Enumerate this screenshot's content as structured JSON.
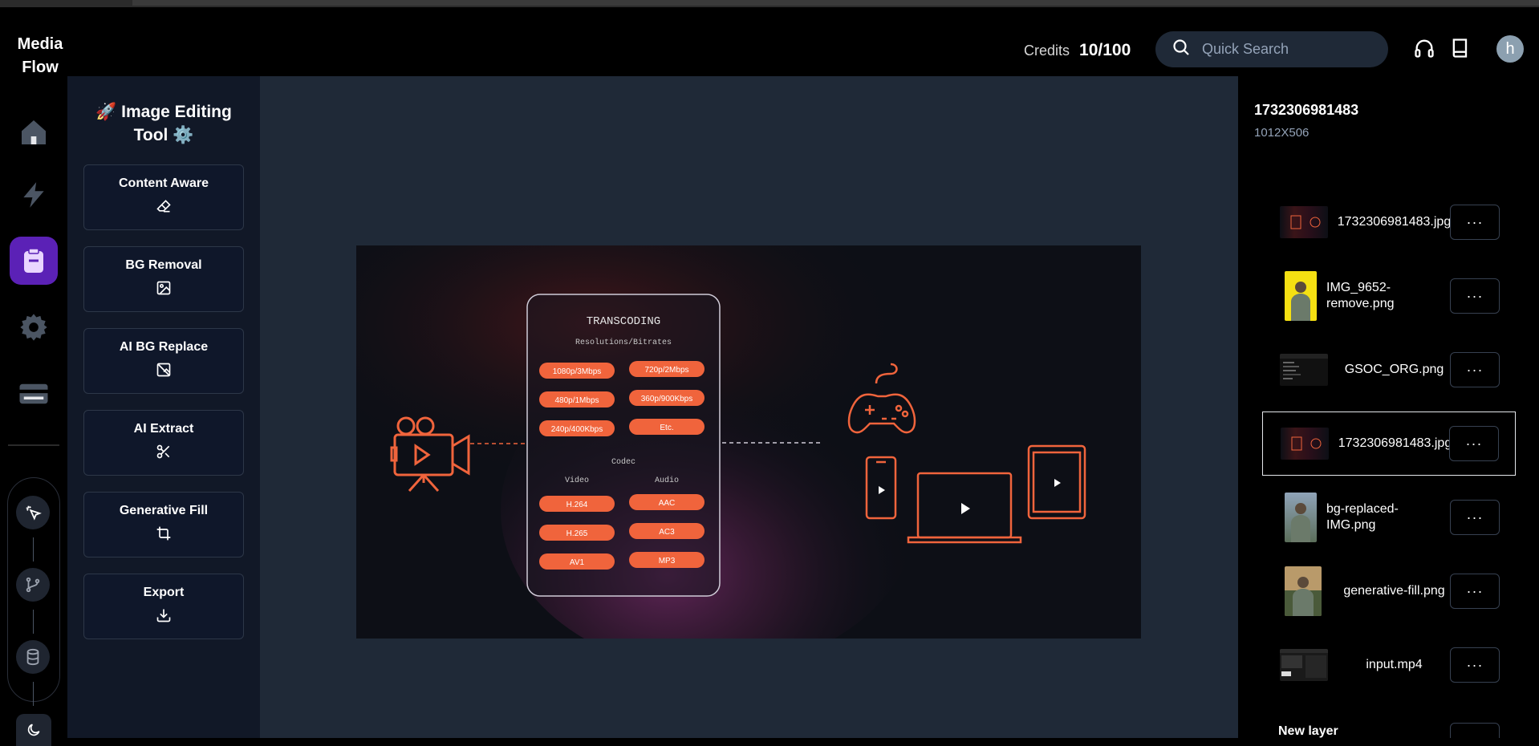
{
  "brand": {
    "line1": "Media",
    "line2": "Flow"
  },
  "header": {
    "credits_label": "Credits",
    "credits_value": "10/100",
    "search_placeholder": "Quick Search",
    "avatar_initial": "h"
  },
  "panel": {
    "title_line1": "🚀 Image Editing",
    "title_line2": "Tool ⚙️",
    "tools": [
      {
        "label": "Content Aware",
        "icon": "eraser-icon"
      },
      {
        "label": "BG Removal",
        "icon": "image-icon"
      },
      {
        "label": "AI BG Replace",
        "icon": "image-off-icon"
      },
      {
        "label": "AI Extract",
        "icon": "scissors-icon"
      },
      {
        "label": "Generative Fill",
        "icon": "crop-icon"
      },
      {
        "label": "Export",
        "icon": "download-icon"
      }
    ]
  },
  "image": {
    "heading": "TRANSCODING",
    "subheading": "Resolutions/Bitrates",
    "bitrates": [
      "1080p/3Mbps",
      "720p/2Mbps",
      "480p/1Mbps",
      "360p/900Kbps",
      "240p/400Kbps",
      "Etc."
    ],
    "codec_label": "Codec",
    "video_label": "Video",
    "audio_label": "Audio",
    "video_codecs": [
      "H.264",
      "H.265",
      "AV1"
    ],
    "audio_codecs": [
      "AAC",
      "AC3",
      "MP3"
    ]
  },
  "file": {
    "name": "1732306981483",
    "dimensions": "1012X506"
  },
  "layers": [
    {
      "name": "1732306981483.jpg",
      "selected": false
    },
    {
      "name": "IMG_9652-remove.png",
      "selected": false
    },
    {
      "name": "GSOC_ORG.png",
      "selected": false
    },
    {
      "name": "1732306981483.jpg",
      "selected": true
    },
    {
      "name": "bg-replaced-IMG.png",
      "selected": false
    },
    {
      "name": "generative-fill.png",
      "selected": false
    },
    {
      "name": "input.mp4",
      "selected": false
    },
    {
      "name": "New layer",
      "selected": false
    }
  ],
  "more_label": "···",
  "colors": {
    "accent": "#5b21b6",
    "orange": "#f0643c",
    "canvas": "#1f2937",
    "panel": "#111827"
  }
}
